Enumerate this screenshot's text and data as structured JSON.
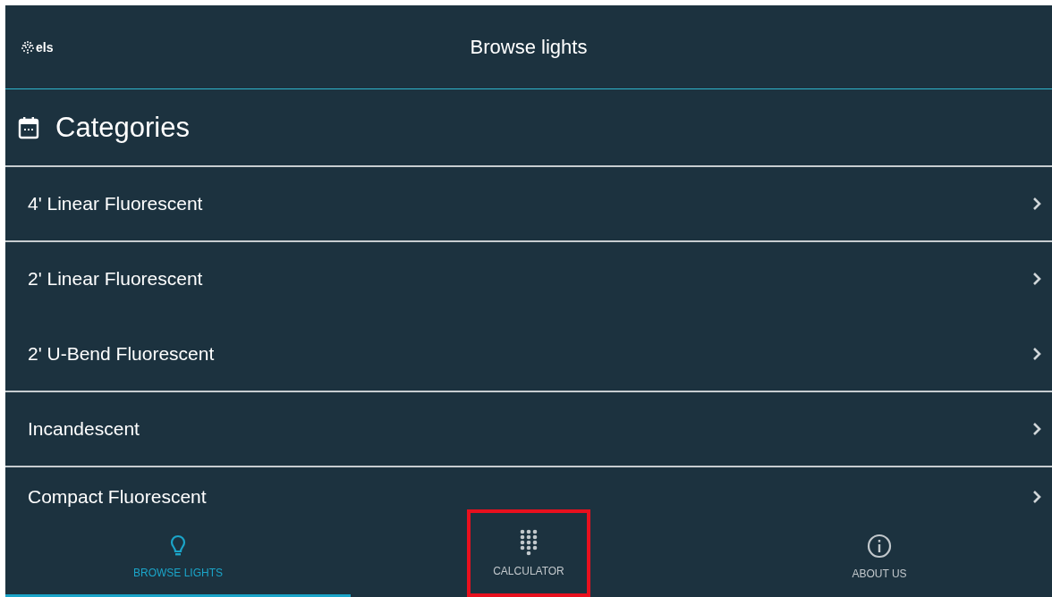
{
  "header": {
    "logo": "els",
    "title": "Browse lights"
  },
  "section": {
    "title": "Categories"
  },
  "categories": [
    {
      "label": "4' Linear Fluorescent",
      "divider_below": true
    },
    {
      "label": "2' Linear Fluorescent",
      "divider_below": false
    },
    {
      "label": "2' U-Bend Fluorescent",
      "divider_below": true
    },
    {
      "label": "Incandescent",
      "divider_below": true
    },
    {
      "label": "Compact Fluorescent",
      "divider_below": false
    }
  ],
  "tabs": [
    {
      "kind": "bulb",
      "label": "BROWSE LIGHTS",
      "selected": true,
      "highlighted": false
    },
    {
      "kind": "keypad",
      "label": "CALCULATOR",
      "selected": false,
      "highlighted": true
    },
    {
      "kind": "info",
      "label": "ABOUT US",
      "selected": false,
      "highlighted": false
    }
  ]
}
